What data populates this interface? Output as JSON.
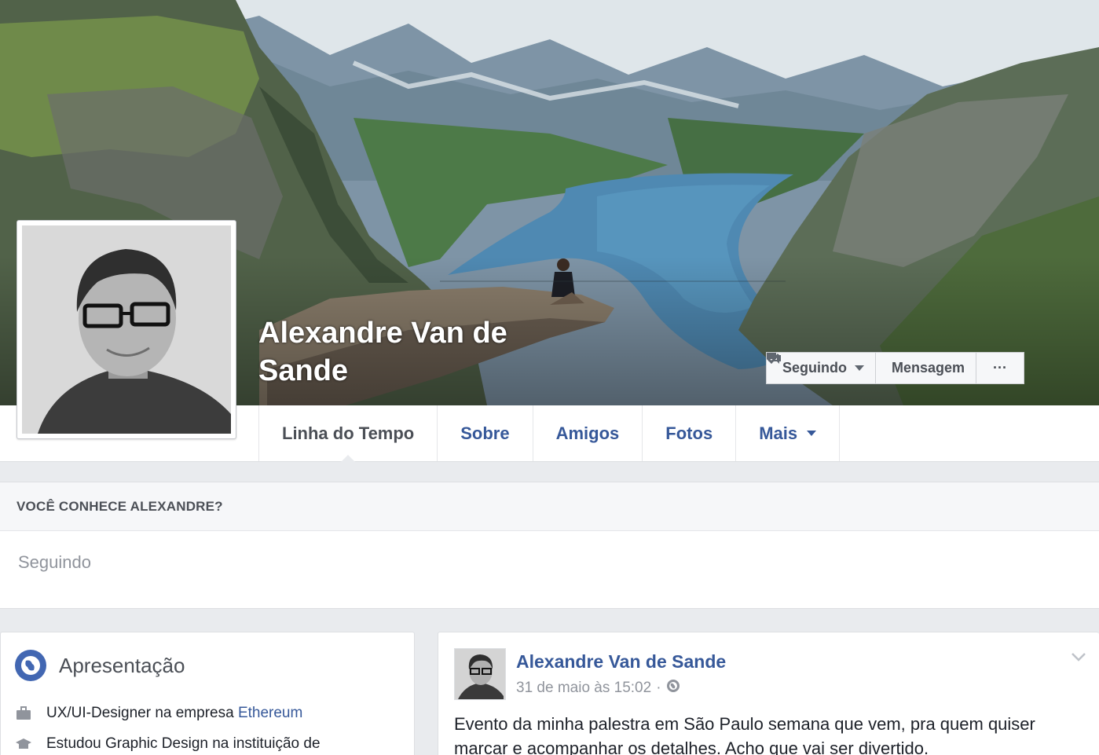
{
  "profile": {
    "name": "Alexandre Van de Sande"
  },
  "cover_actions": {
    "following_label": "Seguindo",
    "message_label": "Mensagem",
    "more_label": "···"
  },
  "nav": {
    "tabs": [
      {
        "label": "Linha do Tempo",
        "active": true
      },
      {
        "label": "Sobre"
      },
      {
        "label": "Amigos"
      },
      {
        "label": "Fotos"
      },
      {
        "label": "Mais"
      }
    ]
  },
  "know_box": {
    "title": "VOCÊ CONHECE ALEXANDRE?",
    "status": "Seguindo"
  },
  "intro": {
    "title": "Apresentação",
    "work_prefix": "UX/UI-Designer na empresa ",
    "work_link": "Ethereum",
    "education_text": "Estudou Graphic Design na instituição de"
  },
  "post": {
    "author": "Alexandre Van de Sande",
    "timestamp": "31 de maio às 15:02",
    "separator": "·",
    "text": "Evento da minha palestra em São Paulo semana que vem, pra quem quiser marcar e acompanhar os detalhes. Acho que vai ser divertido."
  },
  "colors": {
    "link": "#365899",
    "page_bg": "#e9ebee"
  }
}
